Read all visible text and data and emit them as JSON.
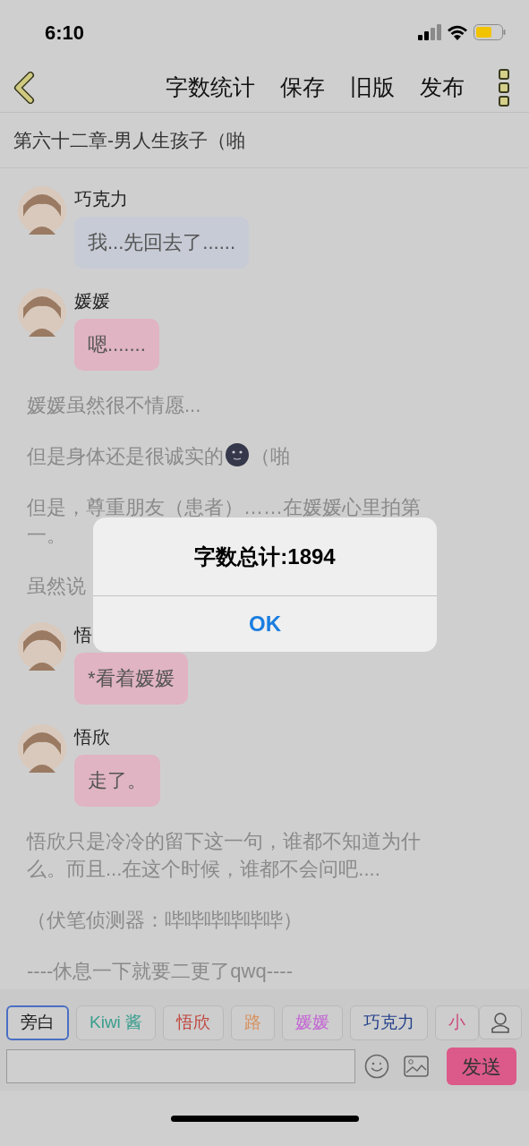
{
  "status_bar": {
    "time": "6:10"
  },
  "nav": {
    "actions": [
      "字数统计",
      "保存",
      "旧版",
      "发布"
    ]
  },
  "chapter_title": "第六十二章-男人生孩子（啪",
  "content": [
    {
      "kind": "message",
      "speaker": "巧克力",
      "text": "我...先回去了......",
      "color": "#c7cbd5"
    },
    {
      "kind": "message",
      "speaker": "媛媛",
      "text": "嗯.......",
      "color": "#e0b4c2"
    },
    {
      "kind": "narration",
      "text": "媛媛虽然很不情愿..."
    },
    {
      "kind": "narration",
      "text": "但是身体还是很诚实的",
      "emoji": true,
      "after": "（啪"
    },
    {
      "kind": "narration",
      "text": "但是，尊重朋友（患者）……在媛媛心里拍第一。"
    },
    {
      "kind": "narration",
      "text": "虽然说"
    },
    {
      "kind": "message",
      "speaker": "悟",
      "text": "*看着媛媛",
      "color": "#e0b4c2"
    },
    {
      "kind": "message",
      "speaker": "悟欣",
      "text": "走了。",
      "color": "#e0b4c2"
    },
    {
      "kind": "narration",
      "text": "悟欣只是冷冷的留下这一句，谁都不知道为什么。而且...在这个时候，谁都不会问吧...."
    },
    {
      "kind": "narration",
      "text": "（伏笔侦测器：哔哔哔哔哔哔）"
    },
    {
      "kind": "narration",
      "text": "----休息一下就要二更了qwq----"
    }
  ],
  "characters": [
    {
      "name": "旁白",
      "color": "#1e1e1e",
      "selected": true
    },
    {
      "name": "Kiwi 酱",
      "color": "#3a9e8e",
      "selected": false
    },
    {
      "name": "悟欣",
      "color": "#c0473f",
      "selected": false
    },
    {
      "name": "路",
      "color": "#d9905c",
      "selected": false
    },
    {
      "name": "媛媛",
      "color": "#c466d4",
      "selected": false
    },
    {
      "name": "巧克力",
      "color": "#23408a",
      "selected": false
    },
    {
      "name": "小",
      "color": "#cc4a7c",
      "selected": false
    }
  ],
  "composer": {
    "send": "发送"
  },
  "alert": {
    "title": "字数总计:1894",
    "button": "OK"
  }
}
